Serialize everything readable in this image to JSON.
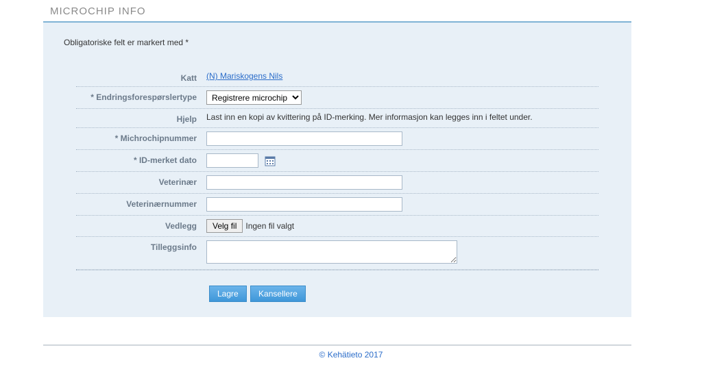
{
  "page": {
    "title": "MICROCHIP INFO",
    "required_note": "Obligatoriske felt er markert med *"
  },
  "form": {
    "katt": {
      "label": "Katt",
      "link_text": "(N) Mariskogens Nils"
    },
    "type": {
      "label": "* Endringsforespørslertype",
      "selected": "Registrere microchip"
    },
    "hjelp": {
      "label": "Hjelp",
      "text": "Last inn en kopi av kvittering på ID-merking. Mer informasjon kan legges inn i feltet under."
    },
    "microchip": {
      "label": "* Michrochipnummer",
      "value": ""
    },
    "dato": {
      "label": "* ID-merket dato",
      "value": ""
    },
    "vet": {
      "label": "Veterinær",
      "value": ""
    },
    "vetnr": {
      "label": "Veterinærnummer",
      "value": ""
    },
    "vedlegg": {
      "label": "Vedlegg",
      "button": "Velg fil",
      "status": "Ingen fil valgt"
    },
    "tilleggs": {
      "label": "Tilleggsinfo",
      "value": ""
    }
  },
  "buttons": {
    "save": "Lagre",
    "cancel": "Kansellere"
  },
  "footer": {
    "text": "© Kehätieto 2017"
  }
}
